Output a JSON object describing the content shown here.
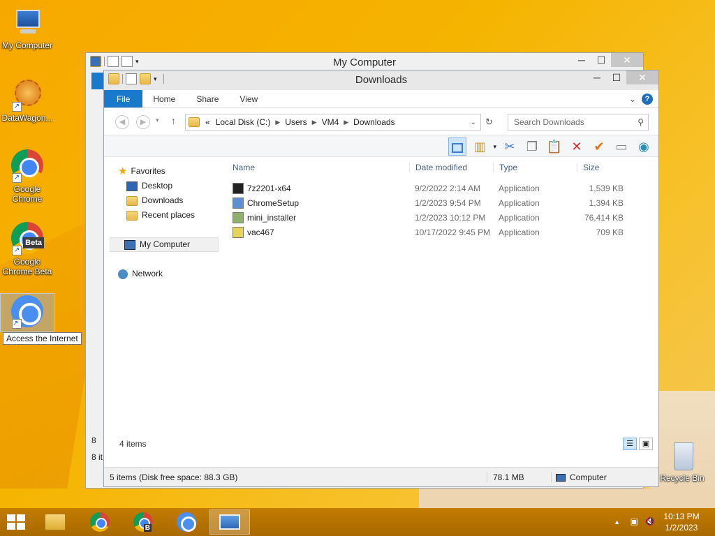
{
  "desktop": {
    "icons": [
      {
        "label": "My Computer"
      },
      {
        "label": "DataWagon..."
      },
      {
        "label": "Google Chrome"
      },
      {
        "label": "Google Chrome Beta"
      },
      {
        "label": "Access the Internet"
      },
      {
        "label": "Recycle Bin"
      }
    ],
    "beta_badge": "Beta",
    "tooltip": "Access the Internet"
  },
  "back_window": {
    "title": "My Computer",
    "status_partial": "8 it",
    "side_partial": "8"
  },
  "window": {
    "title": "Downloads",
    "controls": {
      "minimize": "─",
      "maximize": "☐",
      "close": "✕"
    },
    "ribbon_tabs": [
      "File",
      "Home",
      "Share",
      "View"
    ],
    "address": {
      "overflow": "«",
      "crumbs": [
        "Local Disk (C:)",
        "Users",
        "VM4",
        "Downloads"
      ]
    },
    "search": {
      "placeholder": "Search Downloads"
    },
    "nav": {
      "favorites": "Favorites",
      "desktop": "Desktop",
      "downloads": "Downloads",
      "recent": "Recent places",
      "my_computer": "My Computer",
      "network": "Network"
    },
    "columns": {
      "name": "Name",
      "date": "Date modified",
      "type": "Type",
      "size": "Size"
    },
    "files": [
      {
        "name": "7z2201-x64",
        "date": "9/2/2022 2:14 AM",
        "type": "Application",
        "size": "1,539 KB",
        "icon": "7z-icon"
      },
      {
        "name": "ChromeSetup",
        "date": "1/2/2023 9:54 PM",
        "type": "Application",
        "size": "1,394 KB",
        "icon": "setup-icon"
      },
      {
        "name": "mini_installer",
        "date": "1/2/2023 10:12 PM",
        "type": "Application",
        "size": "76,414 KB",
        "icon": "installer-icon"
      },
      {
        "name": "vac467",
        "date": "10/17/2022 9:45 PM",
        "type": "Application",
        "size": "709 KB",
        "icon": "app-icon"
      }
    ],
    "items_count": "4 items",
    "status": {
      "left": "5 items (Disk free space: 88.3 GB)",
      "size": "78.1 MB",
      "location": "Computer"
    }
  },
  "taskbar": {
    "clock_time": "10:13 PM",
    "clock_date": "1/2/2023",
    "b_badge": "B"
  }
}
